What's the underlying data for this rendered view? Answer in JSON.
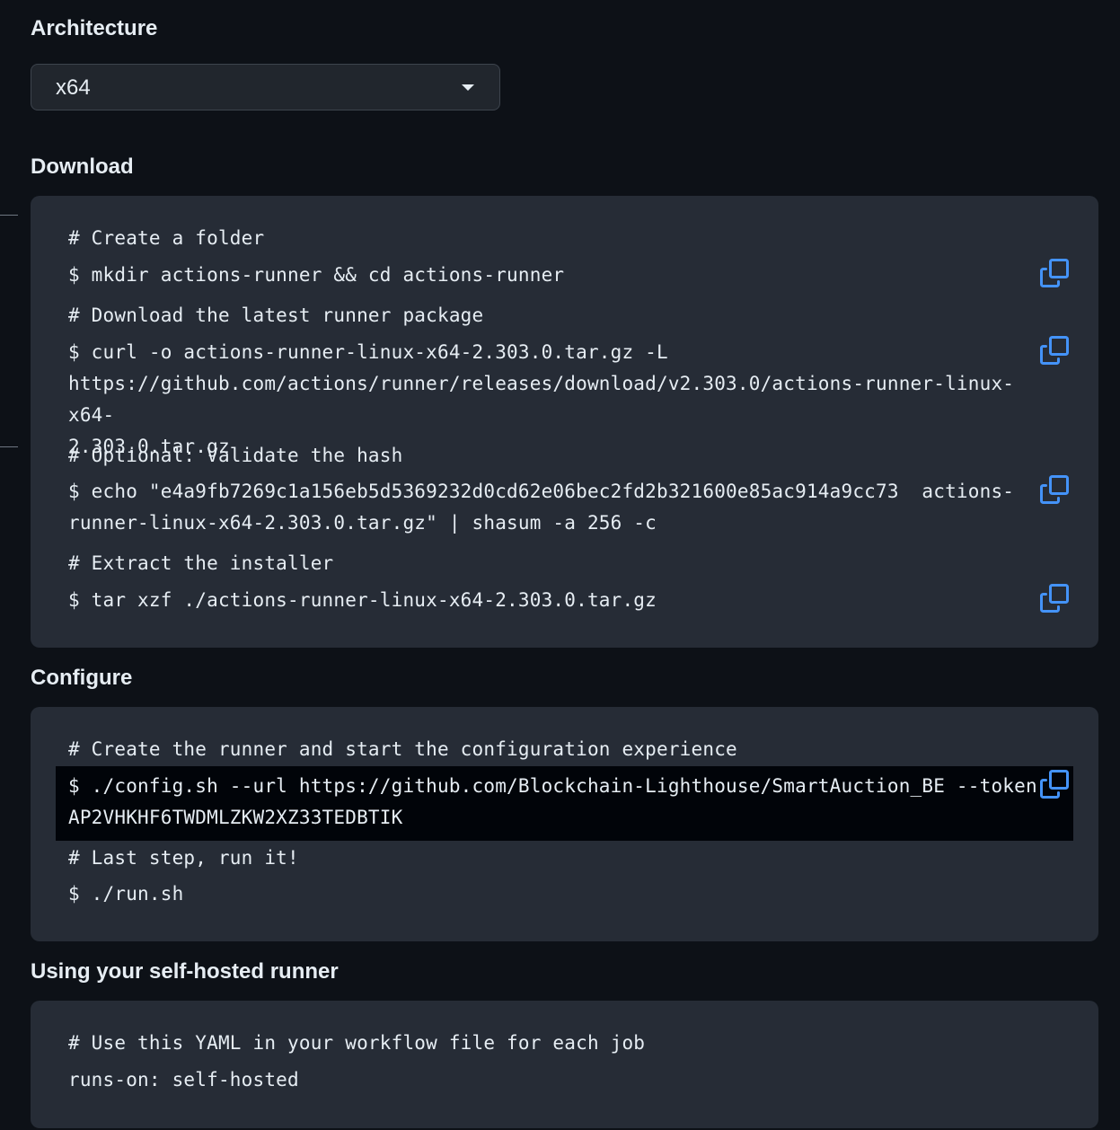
{
  "architecture": {
    "heading": "Architecture",
    "selected": "x64"
  },
  "download": {
    "heading": "Download",
    "lines": {
      "c1": "# Create a folder",
      "cmd1": "$ mkdir actions-runner && cd actions-runner",
      "c2": "# Download the latest runner package",
      "cmd2": "$ curl -o actions-runner-linux-x64-2.303.0.tar.gz -L\nhttps://github.com/actions/runner/releases/download/v2.303.0/actions-runner-linux-x64-\n2.303.0.tar.gz",
      "c3": "# Optional: Validate the hash",
      "cmd3": "$ echo \"e4a9fb7269c1a156eb5d5369232d0cd62e06bec2fd2b321600e85ac914a9cc73  actions-\nrunner-linux-x64-2.303.0.tar.gz\" | shasum -a 256 -c",
      "c4": "# Extract the installer",
      "cmd4": "$ tar xzf ./actions-runner-linux-x64-2.303.0.tar.gz"
    }
  },
  "configure": {
    "heading": "Configure",
    "lines": {
      "c1": "# Create the runner and start the configuration experience",
      "cmd1": "$ ./config.sh --url https://github.com/Blockchain-Lighthouse/SmartAuction_BE --token\nAP2VHKHF6TWDMLZKW2XZ33TEDBTIK",
      "c2": "# Last step, run it!",
      "cmd2": "$ ./run.sh"
    }
  },
  "usage": {
    "heading": "Using your self-hosted runner",
    "lines": {
      "c1": "# Use this YAML in your workflow file for each job",
      "cmd1": "runs-on: self-hosted"
    }
  },
  "icons": {
    "copy": "copy-icon",
    "caret": "triangle-down-icon"
  },
  "colors": {
    "background": "#0d1117",
    "code_bg": "#262c36",
    "highlight_bg": "#010409",
    "copy_icon": "#4493f8"
  }
}
